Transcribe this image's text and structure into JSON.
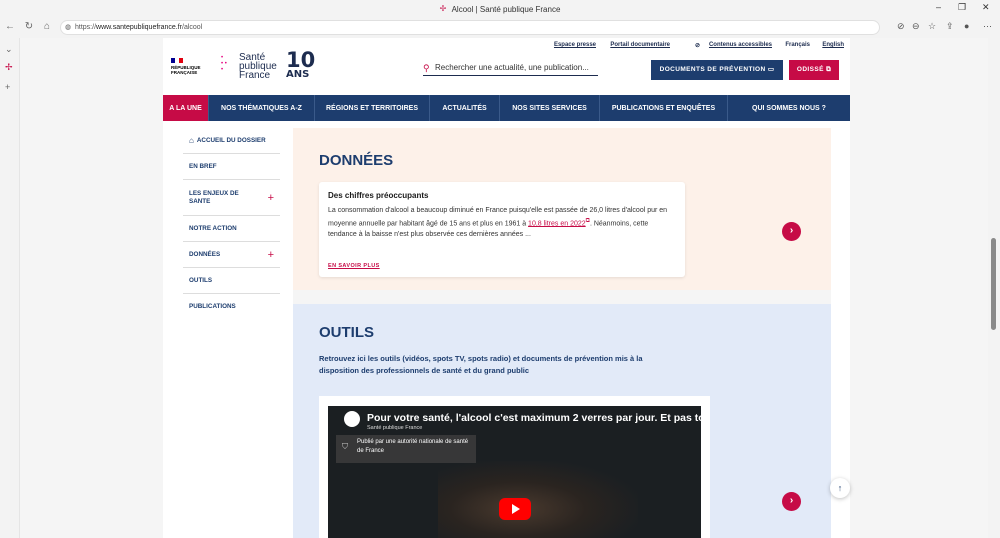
{
  "browser": {
    "tab_title": "Alcool | Santé publique France",
    "url_prefix": "https://",
    "url_host": "www.santepubliquefrance.fr",
    "url_path": "/alcool"
  },
  "header": {
    "top_links": [
      "Espace presse",
      "Portail documentaire",
      "Contenus accessibles",
      "Français",
      "English"
    ],
    "rf_line1": "RÉPUBLIQUE",
    "rf_line2": "FRANÇAISE",
    "logo_line1": "Santé",
    "logo_line2": "publique",
    "logo_line3": "France",
    "anniv_num": "10",
    "anniv_label": "ANS",
    "search_placeholder": "Rechercher une actualité, une publication...",
    "btn_documents": "DOCUMENTS DE PRÉVENTION",
    "btn_odisse": "ODISSÉ"
  },
  "nav": [
    "A LA UNE",
    "NOS THÉMATIQUES A-Z",
    "RÉGIONS ET TERRITOIRES",
    "ACTUALITÉS",
    "NOS SITES SERVICES",
    "PUBLICATIONS ET ENQUÊTES",
    "QUI SOMMES NOUS ?"
  ],
  "leftnav": {
    "home": "ACCUEIL DU DOSSIER",
    "items": [
      "EN BREF",
      "LES ENJEUX DE SANTE",
      "NOTRE ACTION",
      "DONNÉES",
      "OUTILS",
      "PUBLICATIONS"
    ]
  },
  "donnees": {
    "title": "DONNÉES",
    "card_title": "Des chiffres préoccupants",
    "card_text_1": "La consommation d'alcool a beaucoup diminué en France puisqu'elle est passée de 26,0 litres d'alcool pur en moyenne annuelle par habitant âgé de 15 ans et plus en 1961 à ",
    "card_link": "10,8 litres en 2022",
    "card_text_2": ". Néanmoins, cette tendance à la baisse n'est plus observée ces dernières années ...",
    "more": "EN SAVOIR PLUS"
  },
  "outils": {
    "title": "OUTILS",
    "lead": "Retrouvez ici les outils (vidéos, spots TV, spots radio) et documents de prévention mis à la disposition des professionnels de santé et du grand public",
    "video_title": "Pour votre santé, l'alcool c'est maximum 2 verres par jour. Et pas to",
    "video_channel": "Santé publique France",
    "video_notice": "Publié par une autorité nationale de santé de France"
  },
  "colors": {
    "navy": "#1d3d6e",
    "accent": "#c60b46",
    "donnees_bg": "#fdf1e9",
    "outils_bg": "#e2eaf8"
  }
}
